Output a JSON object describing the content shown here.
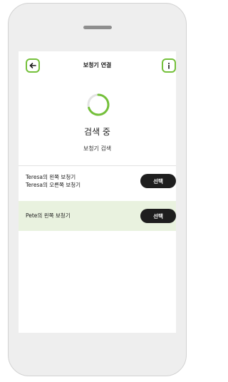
{
  "header": {
    "title": "보청기 연결",
    "back_icon": "arrow-left-icon",
    "info_icon": "info-icon"
  },
  "status": {
    "heading": "검색 중",
    "subheading": "보청기 검색"
  },
  "devices": [
    {
      "lines": [
        "Teresa의 왼쪽 보청기",
        "Teresa의 오른쪽 보청기"
      ],
      "button": "선택",
      "highlighted": false
    },
    {
      "lines": [
        "Pete의 왼쪽 보청기"
      ],
      "button": "선택",
      "highlighted": true
    }
  ],
  "colors": {
    "accent": "#74c03a",
    "highlight_row": "#e9f2df",
    "button": "#1e1e1e"
  }
}
